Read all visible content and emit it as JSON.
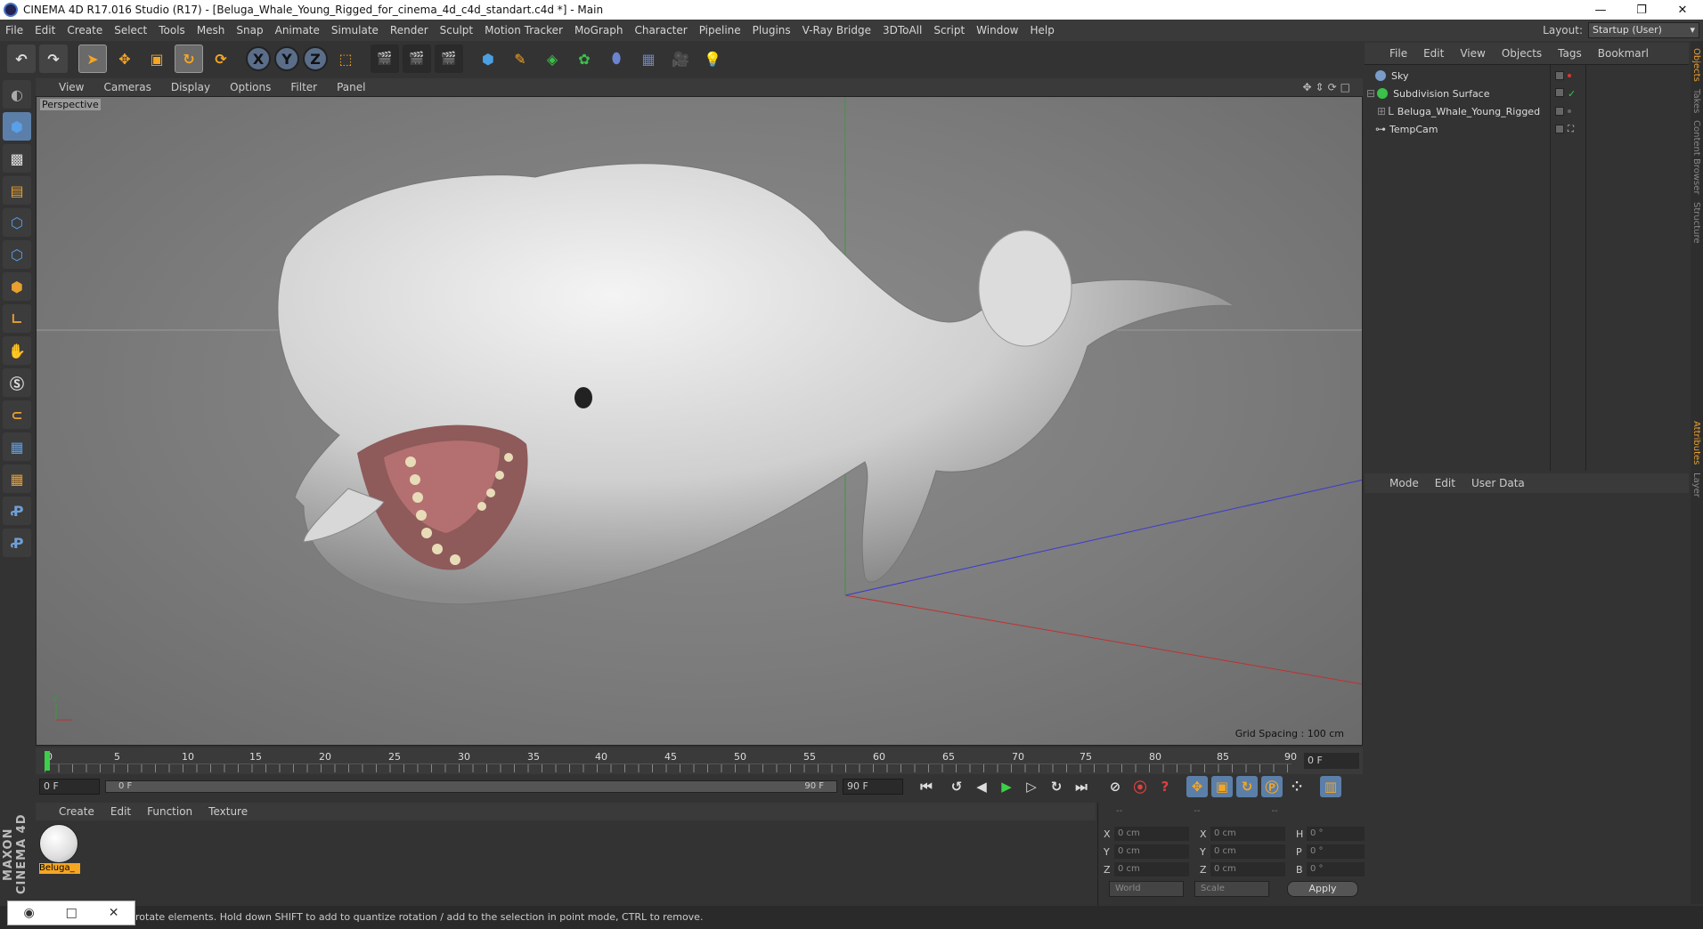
{
  "window": {
    "title": "CINEMA 4D R17.016 Studio (R17) - [Beluga_Whale_Young_Rigged_for_cinema_4d_c4d_standart.c4d *] - Main",
    "controls": [
      "—",
      "❐",
      "✕"
    ]
  },
  "menubar": {
    "items": [
      "File",
      "Edit",
      "Create",
      "Select",
      "Tools",
      "Mesh",
      "Snap",
      "Animate",
      "Simulate",
      "Render",
      "Sculpt",
      "Motion Tracker",
      "MoGraph",
      "Character",
      "Pipeline",
      "Plugins",
      "V-Ray Bridge",
      "3DToAll",
      "Script",
      "Window",
      "Help"
    ],
    "layout_label": "Layout:",
    "layout_value": "Startup (User)"
  },
  "toolbar": {
    "axis": [
      "X",
      "Y",
      "Z"
    ]
  },
  "viewport": {
    "menu": [
      "View",
      "Cameras",
      "Display",
      "Options",
      "Filter",
      "Panel"
    ],
    "label": "Perspective",
    "grid_spacing": "Grid Spacing : 100 cm",
    "nav_icons": "✥⇕⟳□"
  },
  "timeline": {
    "ticks": [
      "0",
      "5",
      "10",
      "15",
      "20",
      "25",
      "30",
      "35",
      "40",
      "45",
      "50",
      "55",
      "60",
      "65",
      "70",
      "75",
      "80",
      "85",
      "90"
    ],
    "current_frame": "0 F"
  },
  "transport": {
    "start": "0 F",
    "range_start": "0 F",
    "range_end": "90 F",
    "end": "90 F"
  },
  "materials": {
    "menu": [
      "Create",
      "Edit",
      "Function",
      "Texture"
    ],
    "items": [
      {
        "name": "Beluga_"
      }
    ]
  },
  "coords": {
    "header": [
      "--",
      "--",
      "--"
    ],
    "rows": [
      {
        "a": "X",
        "v1": "0 cm",
        "b": "X",
        "v2": "0 cm",
        "c": "H",
        "v3": "0 °"
      },
      {
        "a": "Y",
        "v1": "0 cm",
        "b": "Y",
        "v2": "0 cm",
        "c": "P",
        "v3": "0 °"
      },
      {
        "a": "Z",
        "v1": "0 cm",
        "b": "Z",
        "v2": "0 cm",
        "c": "B",
        "v3": "0 °"
      }
    ],
    "world": "World",
    "scale": "Scale",
    "apply": "Apply"
  },
  "objects": {
    "menu": [
      "File",
      "Edit",
      "View",
      "Objects",
      "Tags",
      "Bookmarl"
    ],
    "items": [
      {
        "name": "Sky",
        "indent": 0,
        "color": "#7a9cc8"
      },
      {
        "name": "Subdivision Surface",
        "indent": 0,
        "color": "#3bc04a"
      },
      {
        "name": "Beluga_Whale_Young_Rigged",
        "indent": 1,
        "color": "#aaaaaa"
      },
      {
        "name": "TempCam",
        "indent": 0,
        "color": "#cccccc"
      }
    ]
  },
  "attributes": {
    "menu": [
      "Mode",
      "Edit",
      "User Data"
    ]
  },
  "right_tabs": [
    "Objects",
    "Takes",
    "Content Browser",
    "Structure",
    "Attributes",
    "Layer"
  ],
  "status": {
    "text": "rotate elements. Hold down SHIFT to add to quantize rotation / add to the selection in point mode, CTRL to remove."
  },
  "taskbar_popup": [
    "◉",
    "□",
    "✕"
  ],
  "branding": "MAXON CINEMA 4D"
}
